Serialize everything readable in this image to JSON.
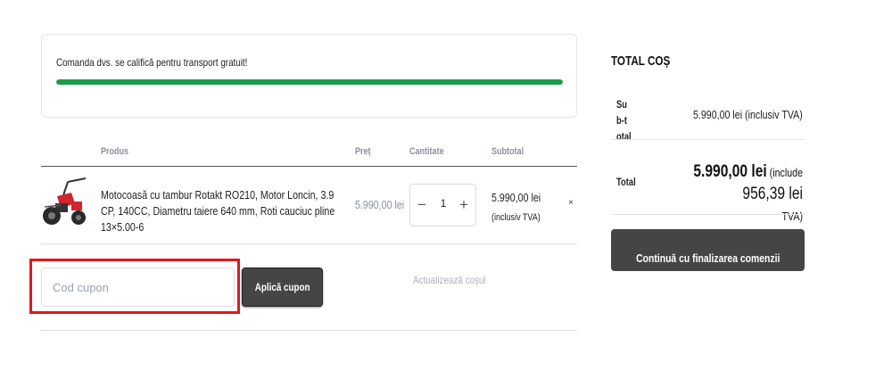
{
  "notice": {
    "text": "Comanda dvs. se califică pentru transport gratuit!",
    "progress_percent": 100,
    "progress_color": "#1a9a4a"
  },
  "cart": {
    "headers": {
      "product": "Produs",
      "price": "Preț",
      "quantity": "Cantitate",
      "subtotal": "Subtotal"
    },
    "items": [
      {
        "name": "Motocoasă cu tambur Rotakt RO210, Motor Loncin, 3.9 CP, 140CC, Diametru taiere 640 mm, Roti cauciuc pline 13×5.00-6",
        "price": "5.990,00 lei",
        "quantity": "1",
        "subtotal": "5.990,00 lei",
        "subtotal_note": "(inclusiv TVA)",
        "remove_icon": "×",
        "thumb_icon": "tiller-machine-image"
      }
    ],
    "qty_minus": "−",
    "qty_plus": "+"
  },
  "coupon": {
    "placeholder": "Cod cupon",
    "apply_label": "Aplică cupon",
    "highlight_color": "#e0171e"
  },
  "update_cart_label": "Actualizează coșul",
  "totals": {
    "title": "TOTAL COȘ",
    "subtotal_label": "Sub-total",
    "subtotal_value": "5.990,00 lei (inclusiv TVA)",
    "total_label": "Total",
    "total_amount": "5.990,00 lei",
    "total_incl": "(include",
    "total_tax": "956,39 lei",
    "total_tax_suffix": "TVA)",
    "checkout_label": "Continuă cu finalizarea comenzii"
  },
  "colors": {
    "button_dark": "#454545",
    "muted_text": "#8a8fa0"
  }
}
